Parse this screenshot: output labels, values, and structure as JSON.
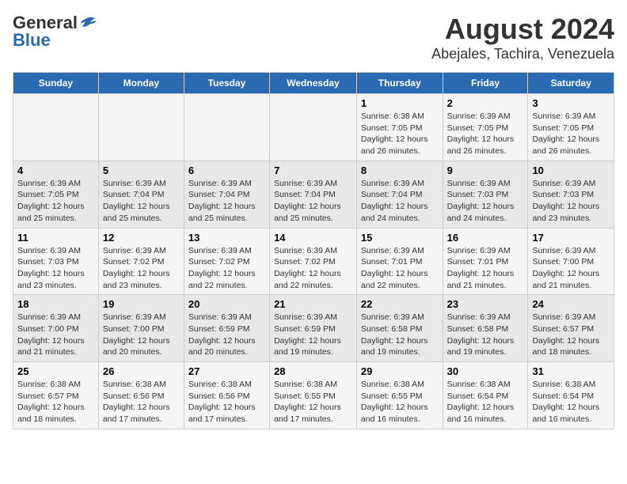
{
  "logo": {
    "line1": "General",
    "line2": "Blue"
  },
  "title": "August 2024",
  "subtitle": "Abejales, Tachira, Venezuela",
  "days_of_week": [
    "Sunday",
    "Monday",
    "Tuesday",
    "Wednesday",
    "Thursday",
    "Friday",
    "Saturday"
  ],
  "weeks": [
    [
      {
        "day": "",
        "info": ""
      },
      {
        "day": "",
        "info": ""
      },
      {
        "day": "",
        "info": ""
      },
      {
        "day": "",
        "info": ""
      },
      {
        "day": "1",
        "info": "Sunrise: 6:38 AM\nSunset: 7:05 PM\nDaylight: 12 hours\nand 26 minutes."
      },
      {
        "day": "2",
        "info": "Sunrise: 6:39 AM\nSunset: 7:05 PM\nDaylight: 12 hours\nand 26 minutes."
      },
      {
        "day": "3",
        "info": "Sunrise: 6:39 AM\nSunset: 7:05 PM\nDaylight: 12 hours\nand 26 minutes."
      }
    ],
    [
      {
        "day": "4",
        "info": "Sunrise: 6:39 AM\nSunset: 7:05 PM\nDaylight: 12 hours\nand 25 minutes."
      },
      {
        "day": "5",
        "info": "Sunrise: 6:39 AM\nSunset: 7:04 PM\nDaylight: 12 hours\nand 25 minutes."
      },
      {
        "day": "6",
        "info": "Sunrise: 6:39 AM\nSunset: 7:04 PM\nDaylight: 12 hours\nand 25 minutes."
      },
      {
        "day": "7",
        "info": "Sunrise: 6:39 AM\nSunset: 7:04 PM\nDaylight: 12 hours\nand 25 minutes."
      },
      {
        "day": "8",
        "info": "Sunrise: 6:39 AM\nSunset: 7:04 PM\nDaylight: 12 hours\nand 24 minutes."
      },
      {
        "day": "9",
        "info": "Sunrise: 6:39 AM\nSunset: 7:03 PM\nDaylight: 12 hours\nand 24 minutes."
      },
      {
        "day": "10",
        "info": "Sunrise: 6:39 AM\nSunset: 7:03 PM\nDaylight: 12 hours\nand 23 minutes."
      }
    ],
    [
      {
        "day": "11",
        "info": "Sunrise: 6:39 AM\nSunset: 7:03 PM\nDaylight: 12 hours\nand 23 minutes."
      },
      {
        "day": "12",
        "info": "Sunrise: 6:39 AM\nSunset: 7:02 PM\nDaylight: 12 hours\nand 23 minutes."
      },
      {
        "day": "13",
        "info": "Sunrise: 6:39 AM\nSunset: 7:02 PM\nDaylight: 12 hours\nand 22 minutes."
      },
      {
        "day": "14",
        "info": "Sunrise: 6:39 AM\nSunset: 7:02 PM\nDaylight: 12 hours\nand 22 minutes."
      },
      {
        "day": "15",
        "info": "Sunrise: 6:39 AM\nSunset: 7:01 PM\nDaylight: 12 hours\nand 22 minutes."
      },
      {
        "day": "16",
        "info": "Sunrise: 6:39 AM\nSunset: 7:01 PM\nDaylight: 12 hours\nand 21 minutes."
      },
      {
        "day": "17",
        "info": "Sunrise: 6:39 AM\nSunset: 7:00 PM\nDaylight: 12 hours\nand 21 minutes."
      }
    ],
    [
      {
        "day": "18",
        "info": "Sunrise: 6:39 AM\nSunset: 7:00 PM\nDaylight: 12 hours\nand 21 minutes."
      },
      {
        "day": "19",
        "info": "Sunrise: 6:39 AM\nSunset: 7:00 PM\nDaylight: 12 hours\nand 20 minutes."
      },
      {
        "day": "20",
        "info": "Sunrise: 6:39 AM\nSunset: 6:59 PM\nDaylight: 12 hours\nand 20 minutes."
      },
      {
        "day": "21",
        "info": "Sunrise: 6:39 AM\nSunset: 6:59 PM\nDaylight: 12 hours\nand 19 minutes."
      },
      {
        "day": "22",
        "info": "Sunrise: 6:39 AM\nSunset: 6:58 PM\nDaylight: 12 hours\nand 19 minutes."
      },
      {
        "day": "23",
        "info": "Sunrise: 6:39 AM\nSunset: 6:58 PM\nDaylight: 12 hours\nand 19 minutes."
      },
      {
        "day": "24",
        "info": "Sunrise: 6:39 AM\nSunset: 6:57 PM\nDaylight: 12 hours\nand 18 minutes."
      }
    ],
    [
      {
        "day": "25",
        "info": "Sunrise: 6:38 AM\nSunset: 6:57 PM\nDaylight: 12 hours\nand 18 minutes."
      },
      {
        "day": "26",
        "info": "Sunrise: 6:38 AM\nSunset: 6:56 PM\nDaylight: 12 hours\nand 17 minutes."
      },
      {
        "day": "27",
        "info": "Sunrise: 6:38 AM\nSunset: 6:56 PM\nDaylight: 12 hours\nand 17 minutes."
      },
      {
        "day": "28",
        "info": "Sunrise: 6:38 AM\nSunset: 6:55 PM\nDaylight: 12 hours\nand 17 minutes."
      },
      {
        "day": "29",
        "info": "Sunrise: 6:38 AM\nSunset: 6:55 PM\nDaylight: 12 hours\nand 16 minutes."
      },
      {
        "day": "30",
        "info": "Sunrise: 6:38 AM\nSunset: 6:54 PM\nDaylight: 12 hours\nand 16 minutes."
      },
      {
        "day": "31",
        "info": "Sunrise: 6:38 AM\nSunset: 6:54 PM\nDaylight: 12 hours\nand 16 minutes."
      }
    ]
  ]
}
